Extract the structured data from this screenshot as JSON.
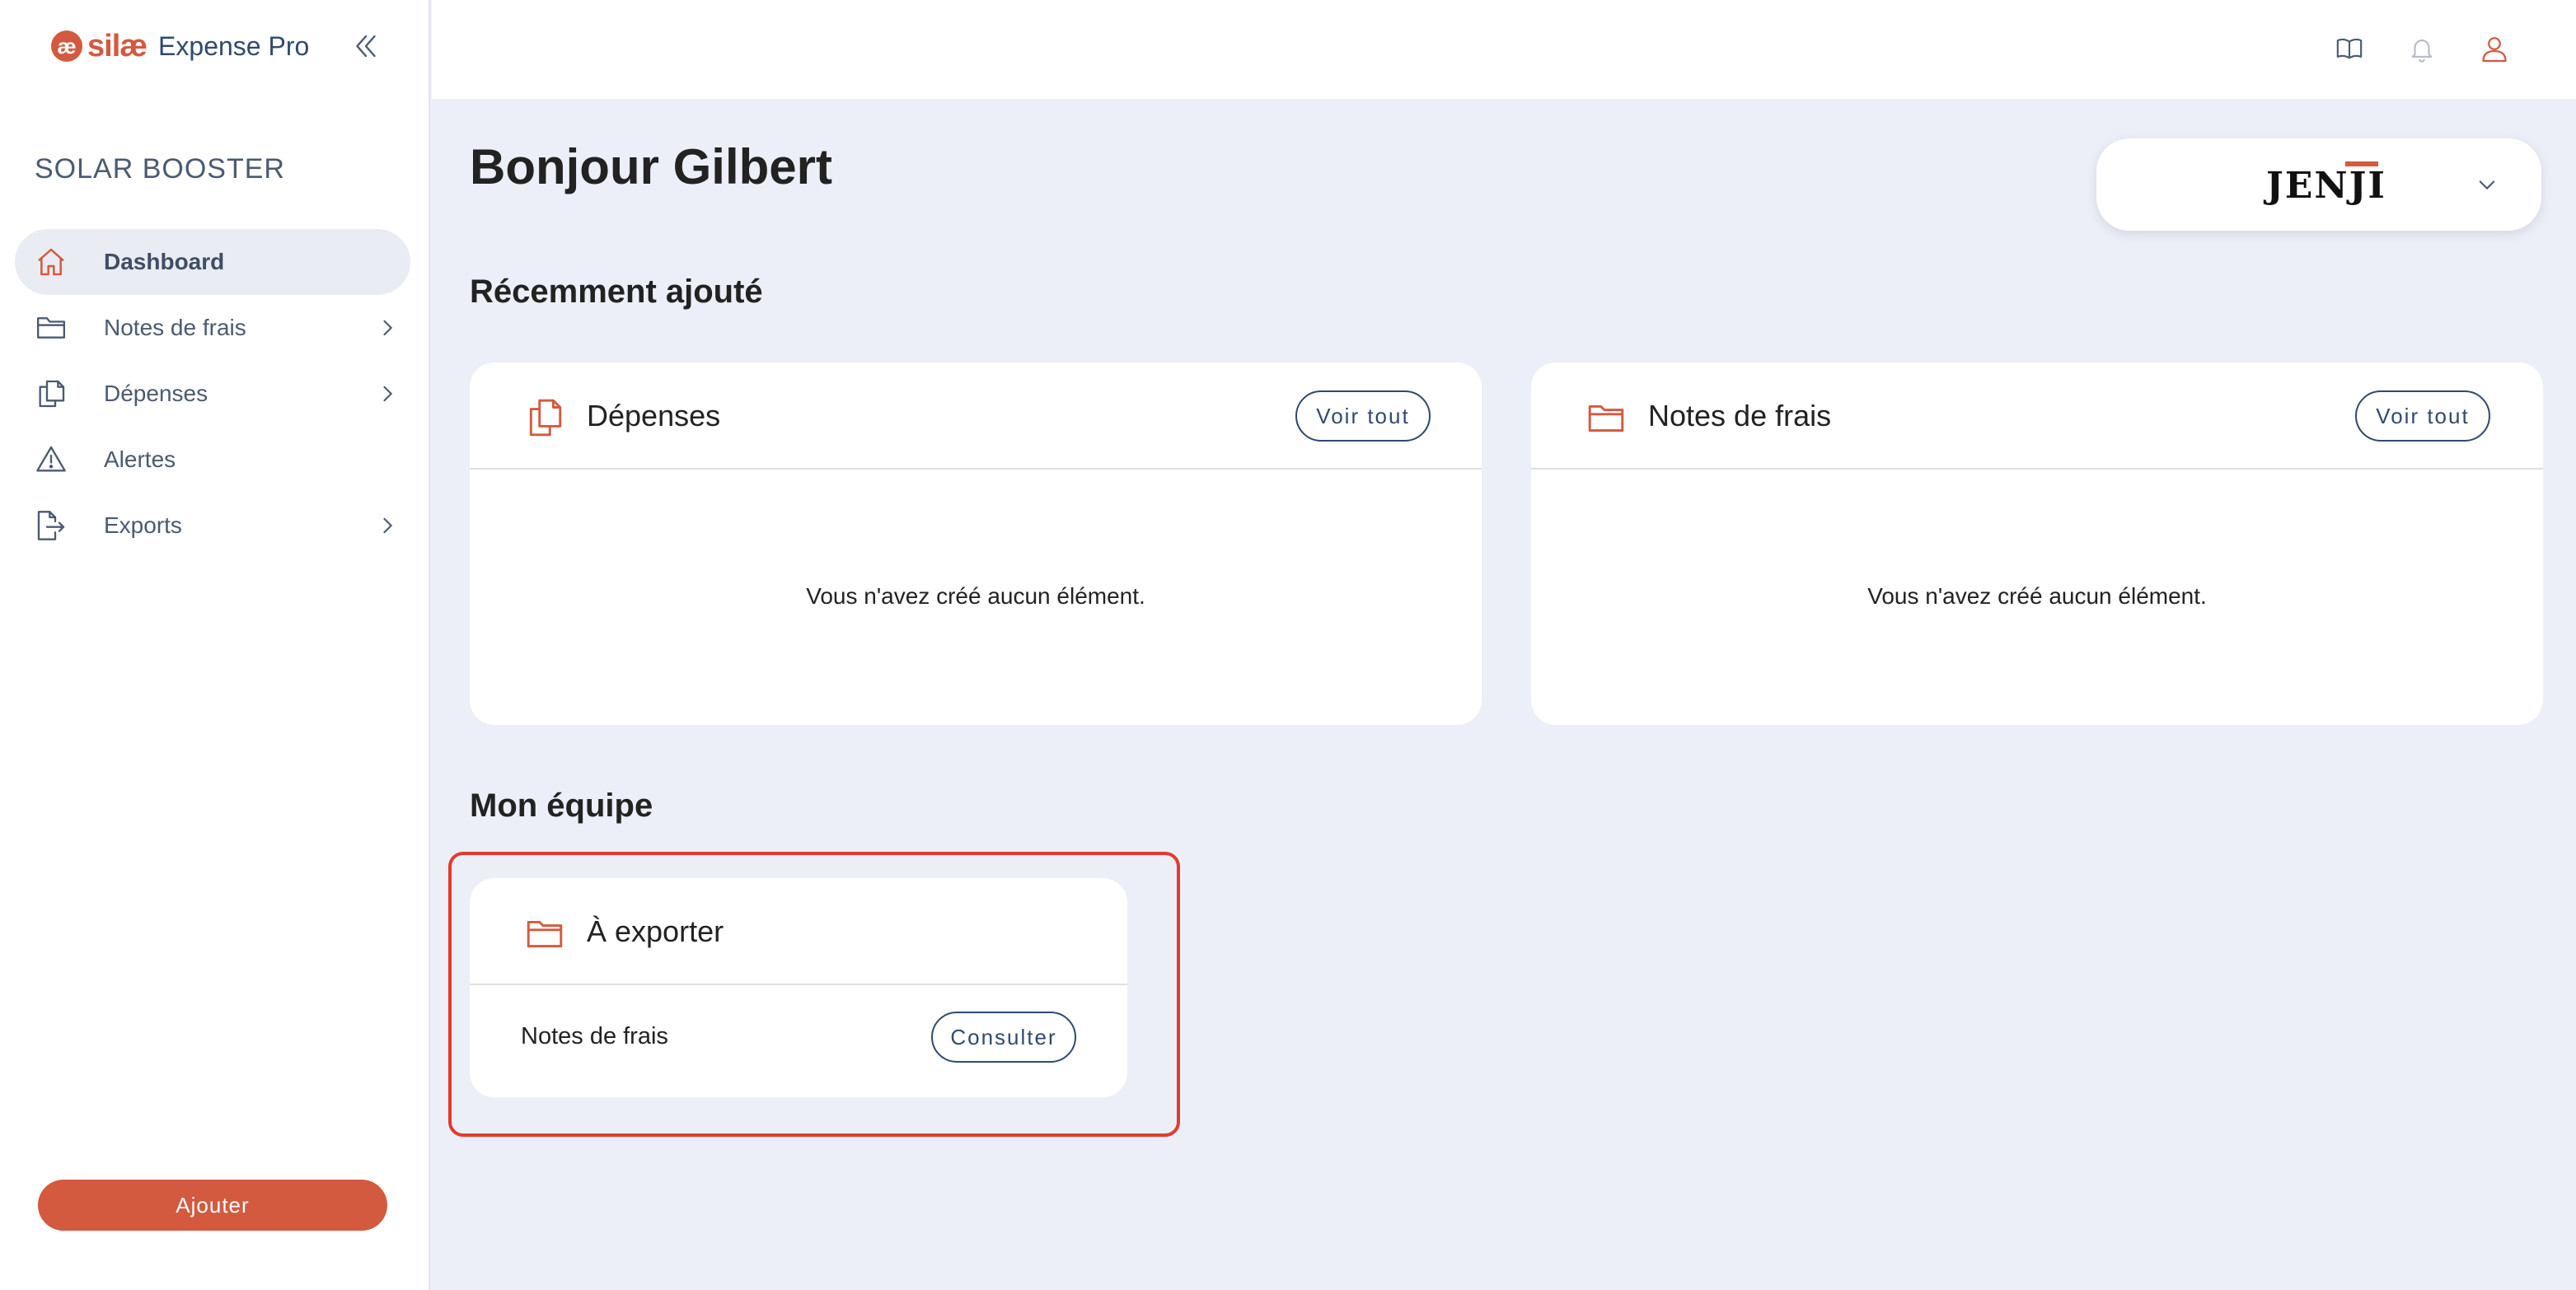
{
  "app": {
    "logo_mark": "æ",
    "brand": "silæ",
    "product": "Expense Pro",
    "company": "SOLAR BOOSTER"
  },
  "sidebar": {
    "items": [
      {
        "label": "Dashboard",
        "icon": "home-icon",
        "active": true,
        "has_submenu": false
      },
      {
        "label": "Notes de frais",
        "icon": "folder-icon",
        "active": false,
        "has_submenu": true
      },
      {
        "label": "Dépenses",
        "icon": "documents-icon",
        "active": false,
        "has_submenu": true
      },
      {
        "label": "Alertes",
        "icon": "warning-icon",
        "active": false,
        "has_submenu": false
      },
      {
        "label": "Exports",
        "icon": "export-icon",
        "active": false,
        "has_submenu": true
      }
    ],
    "add_label": "Ajouter"
  },
  "topbar": {
    "icons": [
      "book-icon",
      "bell-icon",
      "user-icon"
    ]
  },
  "main": {
    "greeting": "Bonjour Gilbert",
    "org_selector": {
      "logo_text": "JENJI"
    },
    "recent": {
      "title": "Récemment ajouté",
      "cards": [
        {
          "title": "Dépenses",
          "button": "Voir tout",
          "empty": "Vous n'avez créé aucun élément."
        },
        {
          "title": "Notes de frais",
          "button": "Voir tout",
          "empty": "Vous n'avez créé aucun élément."
        }
      ]
    },
    "team": {
      "title": "Mon équipe",
      "card": {
        "title": "À exporter",
        "row_label": "Notes de frais",
        "button": "Consulter"
      }
    }
  },
  "colors": {
    "accent": "#d35a3f",
    "navy": "#2f4a6d",
    "background": "#eceff8",
    "highlight": "#e23b2e"
  }
}
